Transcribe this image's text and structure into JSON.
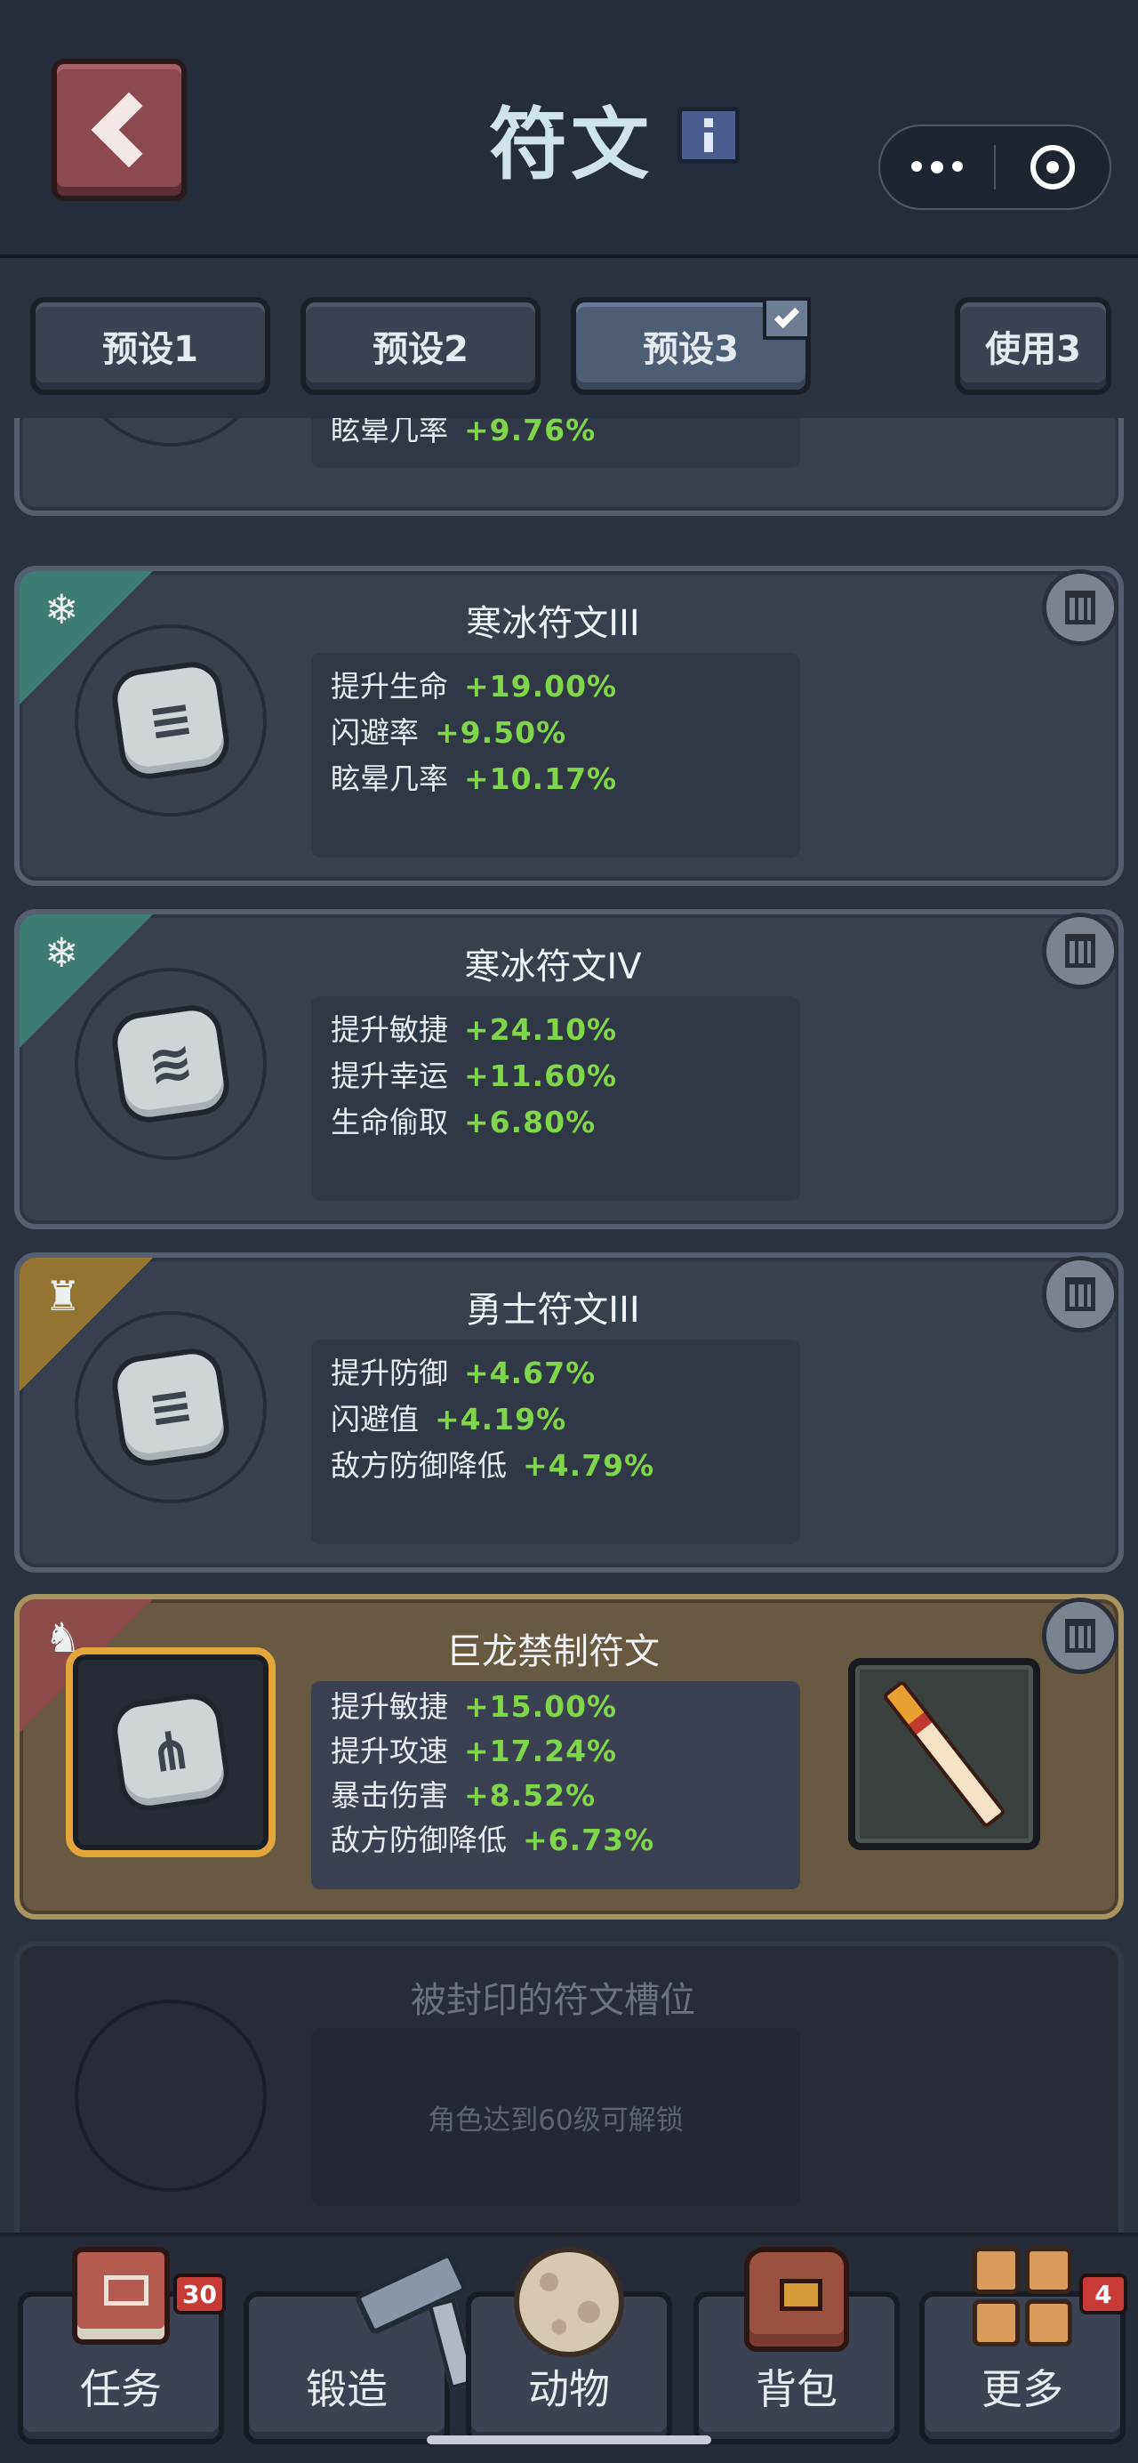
{
  "header": {
    "title": "符文"
  },
  "presets": {
    "tabs": [
      {
        "label": "预设1"
      },
      {
        "label": "预设2"
      },
      {
        "label": "预设3"
      }
    ],
    "use_label": "使用3"
  },
  "partial_card": {
    "stat_label": "眩晕几率",
    "stat_value": "+9.76%"
  },
  "runes": [
    {
      "title": "寒冰符文III",
      "category_icon": "snowflake-icon",
      "rune_glyph": "≡",
      "stats": [
        {
          "label": "提升生命",
          "value": "+19.00%"
        },
        {
          "label": "闪避率",
          "value": "+9.50%"
        },
        {
          "label": "眩晕几率",
          "value": "+10.17%"
        }
      ]
    },
    {
      "title": "寒冰符文IV",
      "category_icon": "snowflake-icon",
      "rune_glyph": "≋",
      "stats": [
        {
          "label": "提升敏捷",
          "value": "+24.10%"
        },
        {
          "label": "提升幸运",
          "value": "+11.60%"
        },
        {
          "label": "生命偷取",
          "value": "+6.80%"
        }
      ]
    },
    {
      "title": "勇士符文III",
      "category_icon": "helmet-icon",
      "rune_glyph": "≡",
      "stats": [
        {
          "label": "提升防御",
          "value": "+4.67%"
        },
        {
          "label": "闪避值",
          "value": "+4.19%"
        },
        {
          "label": "敌方防御降低",
          "value": "+4.79%"
        }
      ]
    },
    {
      "title": "巨龙禁制符文",
      "category_icon": "dragon-icon",
      "rune_glyph": "⋔",
      "equipped_item_icon": "sword-icon",
      "stats": [
        {
          "label": "提升敏捷",
          "value": "+15.00%"
        },
        {
          "label": "提升攻速",
          "value": "+17.24%"
        },
        {
          "label": "暴击伤害",
          "value": "+8.52%"
        },
        {
          "label": "敌方防御降低",
          "value": "+6.73%"
        }
      ]
    }
  ],
  "sealed_slot": {
    "title": "被封印的符文槽位",
    "hint": "角色达到60级可解锁"
  },
  "bottom_nav": [
    {
      "label": "任务",
      "icon": "quest-book-icon",
      "badge": "30"
    },
    {
      "label": "锻造",
      "icon": "hammer-icon",
      "badge": ""
    },
    {
      "label": "动物",
      "icon": "egg-icon",
      "badge": ""
    },
    {
      "label": "背包",
      "icon": "backpack-icon",
      "badge": ""
    },
    {
      "label": "更多",
      "icon": "grid-icon",
      "badge": "4"
    }
  ]
}
